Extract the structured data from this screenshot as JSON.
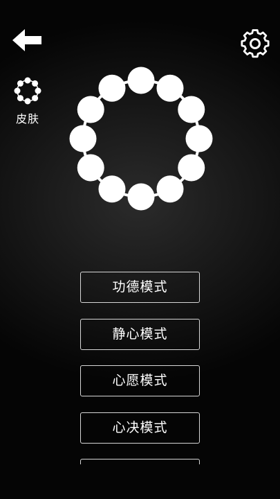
{
  "header": {
    "back_icon": "arrow-left-icon",
    "settings_icon": "gear-icon"
  },
  "skin": {
    "icon": "bead-bracelet-icon",
    "label": "皮肤"
  },
  "bracelet": {
    "bead_count": 12,
    "bead_color": "#ffffff",
    "string_color": "#ffffff"
  },
  "modes": [
    {
      "label": "功德模式"
    },
    {
      "label": "静心模式"
    },
    {
      "label": "心愿模式"
    },
    {
      "label": "心决模式"
    },
    {
      "label": ""
    }
  ],
  "colors": {
    "background": "#0d0d0d",
    "text": "#ffffff",
    "button_border": "#d8d8d8"
  }
}
